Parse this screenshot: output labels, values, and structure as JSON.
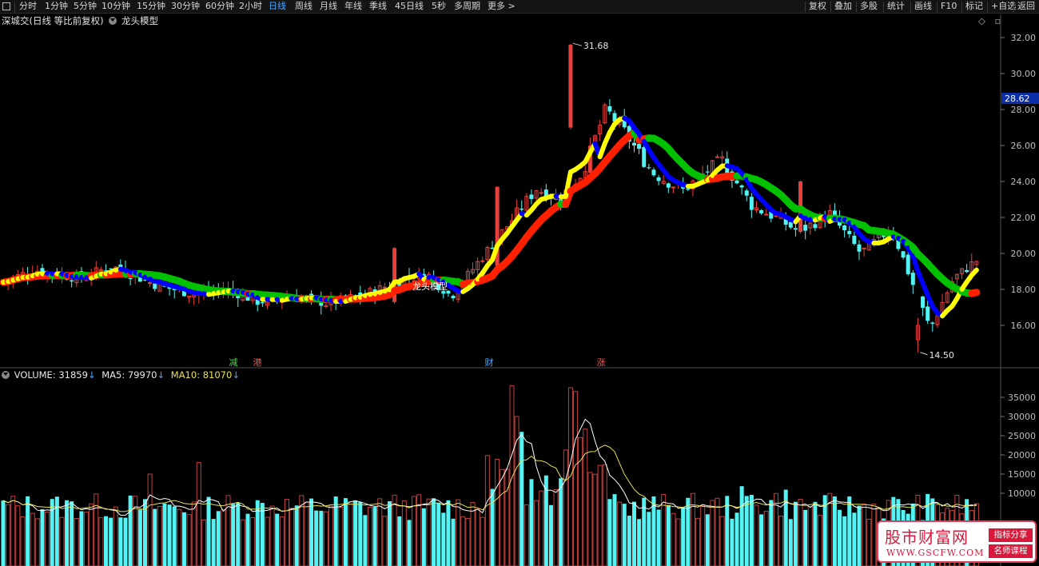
{
  "toolbar": {
    "left": [
      "分时",
      "1分钟",
      "5分钟",
      "10分钟",
      "15分钟",
      "30分钟",
      "60分钟",
      "2小时",
      "日线",
      "周线",
      "月线",
      "年线",
      "季线",
      "45日线",
      "5秒",
      "多周期",
      "更多 >"
    ],
    "active": "日线",
    "right": [
      "复权",
      "叠加",
      "多股",
      "统计",
      "画线",
      "F10",
      "标记",
      "+自选",
      "返回"
    ]
  },
  "header": {
    "title": "深城交(日线 等比前复权)",
    "indicator": "龙头模型"
  },
  "price": {
    "yticks": [
      "32.00",
      "30.00",
      "28.00",
      "26.00",
      "24.00",
      "22.00",
      "20.00",
      "18.00",
      "16.00"
    ],
    "current": "28.62",
    "high_label": "31.68",
    "low_label": "14.50",
    "inline_label": "龙头模型",
    "markers": [
      "减",
      "港",
      "财",
      "涨"
    ]
  },
  "volume": {
    "label": "VOLUME: 31859",
    "ma5": "MA5: 79970",
    "ma10": "MA10: 81070",
    "yticks": [
      "35000",
      "30000",
      "25000",
      "20000",
      "15000",
      "10000"
    ]
  },
  "watermark": {
    "title": "股市财富网",
    "url": "WWW.GSCFW.COM",
    "tag1": "指标分享",
    "tag2": "名师课程"
  },
  "colors": {
    "up": "#e8403c",
    "down": "#54f4f4",
    "ma5": "#ffffff",
    "ma10": "#e8e05a",
    "band_yellow": "#ffff00",
    "band_blue": "#0000ff",
    "band_red": "#ff2000",
    "band_green": "#00c000",
    "active_tab": "#4fa6ff"
  }
}
